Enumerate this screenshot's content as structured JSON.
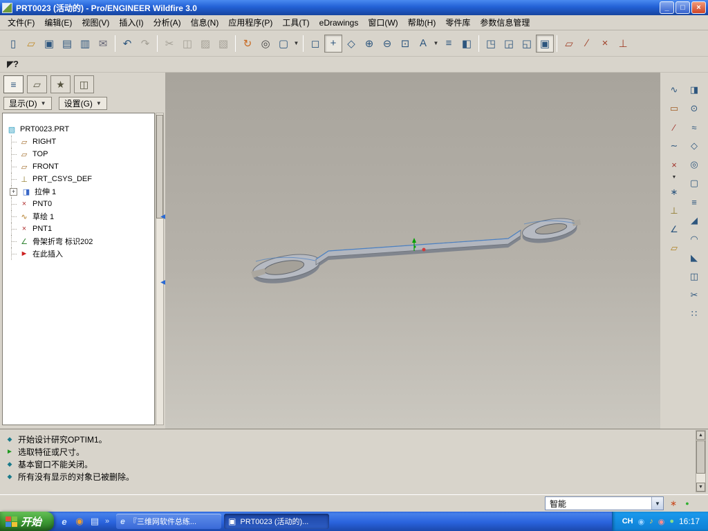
{
  "colors": {
    "titlebar_blue": "#2361d6",
    "chrome_gray": "#d8d4cb",
    "viewport_top": "#a8a49c",
    "viewport_bottom": "#cbc8c0",
    "taskbar_blue": "#2a63dd",
    "start_green": "#3d9a34",
    "tray_blue": "#128ee2",
    "toolbar_icon_blue": "#2d567e",
    "model_edge_highlight": "#4b80c2"
  },
  "ui": {
    "dropdown_arrow": "▼",
    "scroll_up": "▲",
    "scroll_down": "▼",
    "chevron": "»",
    "collapse_arrow": "◀",
    "expander": "+"
  },
  "window": {
    "title": "PRT0023 (活动的) - Pro/ENGINEER Wildfire 3.0",
    "minimize_glyph": "_",
    "maximize_glyph": "□",
    "close_glyph": "×"
  },
  "menu": {
    "items": [
      "文件(F)",
      "编辑(E)",
      "视图(V)",
      "插入(I)",
      "分析(A)",
      "信息(N)",
      "应用程序(P)",
      "工具(T)",
      "eDrawings",
      "窗口(W)",
      "帮助(H)",
      "零件库",
      "参数信息管理"
    ]
  },
  "helper": {
    "context_help_glyph": "◤?"
  },
  "toolbar": {
    "icons": [
      {
        "name": "new-file-icon",
        "glyph": "▯"
      },
      {
        "name": "open-icon",
        "glyph": "▱"
      },
      {
        "name": "save-icon",
        "glyph": "▣"
      },
      {
        "name": "print-icon",
        "glyph": "▤"
      },
      {
        "name": "print-drawing-icon",
        "glyph": "▥"
      },
      {
        "name": "email-icon",
        "glyph": "✉"
      },
      {
        "name": "undo-icon",
        "glyph": "↶"
      },
      {
        "name": "redo-icon",
        "glyph": "↷"
      },
      {
        "name": "cut-icon",
        "glyph": "✂"
      },
      {
        "name": "copy-icon",
        "glyph": "◫"
      },
      {
        "name": "paste-icon",
        "glyph": "▨"
      },
      {
        "name": "paste-special-icon",
        "glyph": "▧"
      },
      {
        "name": "regenerate-icon",
        "glyph": "↻"
      },
      {
        "name": "find-icon",
        "glyph": "◎"
      },
      {
        "name": "selection-filter-icon",
        "glyph": "▢"
      },
      {
        "name": "repaint-icon",
        "glyph": "◻"
      },
      {
        "name": "spin-center-icon",
        "glyph": "+"
      },
      {
        "name": "orient-mode-icon",
        "glyph": "◇"
      },
      {
        "name": "zoom-in-icon",
        "glyph": "⊕"
      },
      {
        "name": "zoom-out-icon",
        "glyph": "⊖"
      },
      {
        "name": "zoom-fit-icon",
        "glyph": "⊡"
      },
      {
        "name": "saved-views-icon",
        "glyph": "A"
      },
      {
        "name": "layers-icon",
        "glyph": "≡"
      },
      {
        "name": "view-manager-icon",
        "glyph": "◧"
      },
      {
        "name": "window-1-icon",
        "glyph": "◳"
      },
      {
        "name": "window-2-icon",
        "glyph": "◲"
      },
      {
        "name": "window-3-icon",
        "glyph": "◱"
      },
      {
        "name": "active-window-icon",
        "glyph": "▣"
      },
      {
        "name": "datum-plane-display-icon",
        "glyph": "▱"
      },
      {
        "name": "datum-axis-display-icon",
        "glyph": "∕"
      },
      {
        "name": "datum-point-display-icon",
        "glyph": "×"
      },
      {
        "name": "csys-display-icon",
        "glyph": "⊥"
      }
    ]
  },
  "nav_tabs": {
    "tabs": [
      {
        "name": "model-tree-tab",
        "glyph": "≡"
      },
      {
        "name": "folder-browser-tab",
        "glyph": "▱"
      },
      {
        "name": "favorites-tab",
        "glyph": "★"
      },
      {
        "name": "connections-tab",
        "glyph": "◫"
      }
    ]
  },
  "tree": {
    "show_button": "显示(D)",
    "settings_button": "设置(G)",
    "items": [
      {
        "icon": "part-icon",
        "glyph": "▧",
        "label": "PRT0023.PRT"
      },
      {
        "icon": "datum-plane-icon",
        "glyph": "▱",
        "label": "RIGHT"
      },
      {
        "icon": "datum-plane-icon",
        "glyph": "▱",
        "label": "TOP"
      },
      {
        "icon": "datum-plane-icon",
        "glyph": "▱",
        "label": "FRONT"
      },
      {
        "icon": "csys-icon",
        "glyph": "⊥",
        "label": "PRT_CSYS_DEF"
      },
      {
        "icon": "extrude-feature-icon",
        "glyph": "◨",
        "label": "拉伸 1",
        "expandable": true
      },
      {
        "icon": "datum-point-icon",
        "glyph": "×",
        "label": "PNT0"
      },
      {
        "icon": "sketch-icon",
        "glyph": "∿",
        "label": "草绘 1"
      },
      {
        "icon": "datum-point-icon",
        "glyph": "×",
        "label": "PNT1"
      },
      {
        "icon": "bend-feature-icon",
        "glyph": "∠",
        "label": "骨架折弯 标识202"
      },
      {
        "icon": "insert-here-icon",
        "glyph": "►",
        "label": "在此插入"
      }
    ]
  },
  "right_toolbar": {
    "colA": [
      {
        "name": "style-tool-icon",
        "glyph": "∿"
      },
      {
        "name": "datum-plane-tool-icon",
        "glyph": "▭"
      },
      {
        "name": "datum-axis-tool-icon",
        "glyph": "∕"
      },
      {
        "name": "curve-tool-icon",
        "glyph": "∼"
      },
      {
        "name": "datum-point-tool-icon",
        "glyph": "×"
      },
      {
        "name": "field-point-tool-icon",
        "glyph": "∗"
      },
      {
        "name": "csys-tool-icon",
        "glyph": "⊥"
      },
      {
        "name": "analysis-tool-icon",
        "glyph": "∠"
      },
      {
        "name": "sketch-tool-icon",
        "glyph": "▱"
      }
    ],
    "colB": [
      {
        "name": "extrude-tool-icon",
        "glyph": "◨"
      },
      {
        "name": "revolve-tool-icon",
        "glyph": "⊙"
      },
      {
        "name": "sweep-tool-icon",
        "glyph": "≈"
      },
      {
        "name": "blend-tool-icon",
        "glyph": "◇"
      },
      {
        "name": "hole-tool-icon",
        "glyph": "◎"
      },
      {
        "name": "shell-tool-icon",
        "glyph": "▢"
      },
      {
        "name": "rib-tool-icon",
        "glyph": "≡"
      },
      {
        "name": "draft-tool-icon",
        "glyph": "◢"
      },
      {
        "name": "round-tool-icon",
        "glyph": "◠"
      },
      {
        "name": "chamfer-tool-icon",
        "glyph": "◣"
      },
      {
        "name": "mirror-tool-icon",
        "glyph": "◫"
      },
      {
        "name": "trim-tool-icon",
        "glyph": "✂"
      },
      {
        "name": "pattern-tool-icon",
        "glyph": "∷"
      }
    ]
  },
  "messages": {
    "lines": [
      {
        "bullet": "◆",
        "text": "开始设计研究OPTIM1。"
      },
      {
        "bullet": "►",
        "text": "选取特征或尺寸。"
      },
      {
        "bullet": "◆",
        "text": "基本窗口不能关闭。"
      },
      {
        "bullet": "◆",
        "text": "所有没有显示的对象已被删除。"
      }
    ]
  },
  "status": {
    "filter_value": "智能",
    "icons": [
      {
        "name": "find-tool-icon",
        "glyph": "∗"
      },
      {
        "name": "status-led-icon",
        "glyph": "●"
      }
    ]
  },
  "taskbar": {
    "start_label": "开始",
    "quick_launch": [
      {
        "name": "ie-icon",
        "glyph": "e"
      },
      {
        "name": "media-player-icon",
        "glyph": "◉"
      },
      {
        "name": "show-desktop-icon",
        "glyph": "▤"
      }
    ],
    "tasks": [
      {
        "icon_glyph": "e",
        "label": "『三维网软件总练..."
      },
      {
        "icon_glyph": "▣",
        "label": "PRT0023 (活动的)..."
      }
    ],
    "tray": {
      "lang": "CH",
      "icons": [
        {
          "name": "messenger-icon",
          "glyph": "◉"
        },
        {
          "name": "volume-icon",
          "glyph": "♪"
        },
        {
          "name": "security-icon",
          "glyph": "◉"
        },
        {
          "name": "power-icon",
          "glyph": "●"
        }
      ],
      "time": "16:17"
    }
  }
}
